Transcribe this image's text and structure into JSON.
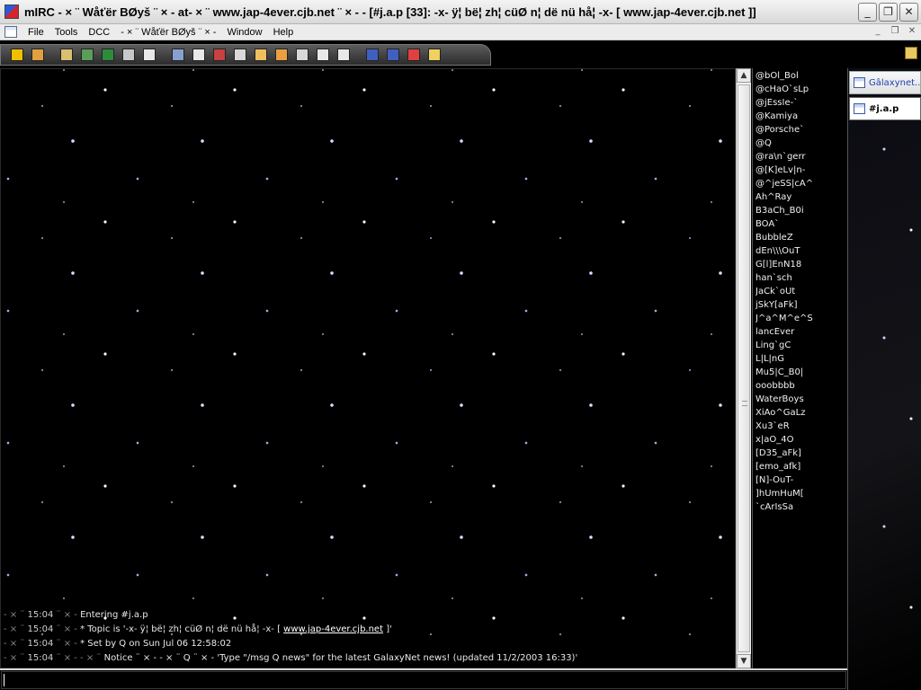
{
  "titlebar": {
    "title": "mIRC - × ¨ Wåťër BØyš ¨ × - at- × ¨ www.jap-4ever.cjb.net ¨ × - - [#j.a.p [33]: -x- ÿ¦ bë¦ zh¦ cüØ n¦ dë nü hå¦ -x- [ www.jap-4ever.cjb.net ]]",
    "minimize": "_",
    "maximize": "❐",
    "close": "✕"
  },
  "menubar": {
    "items": [
      "File",
      "Tools",
      "DCC",
      "- × ¨ Wåťër BØyš ¨ × -",
      "Window",
      "Help"
    ],
    "mdi": [
      "_",
      "❐",
      "✕"
    ]
  },
  "toolbar": {
    "buttons": [
      {
        "name": "connect",
        "color": "#f0c000"
      },
      {
        "name": "options",
        "color": "#e0a040"
      },
      {
        "name": "channels",
        "color": "#d8c070"
      },
      {
        "name": "address-book",
        "color": "#5a9e5a"
      },
      {
        "name": "remote",
        "color": "#2c8c3c"
      },
      {
        "name": "colors",
        "color": "#c8c8c8"
      },
      {
        "name": "channels-list",
        "color": "#e8e8e8"
      },
      {
        "name": "send-file",
        "color": "#88a0d0"
      },
      {
        "name": "timer",
        "color": "#e8e8e8"
      },
      {
        "name": "chat",
        "color": "#c84040"
      },
      {
        "name": "notify",
        "color": "#d8d8d8"
      },
      {
        "name": "log",
        "color": "#f0c060"
      },
      {
        "name": "url",
        "color": "#e8a040"
      },
      {
        "name": "sound",
        "color": "#d8d8d8"
      },
      {
        "name": "tile-horizontal",
        "color": "#e8e8e8"
      },
      {
        "name": "tile-vertical",
        "color": "#e8e8e8"
      },
      {
        "name": "cascade",
        "color": "#4060c0"
      },
      {
        "name": "arrange",
        "color": "#4060c0"
      },
      {
        "name": "help",
        "color": "#e04040"
      },
      {
        "name": "lock",
        "color": "#f0d060"
      }
    ]
  },
  "chat": {
    "lines": [
      {
        "prefix": "- × ¨ ",
        "time": "15:04",
        "sep": " ¨ × - ",
        "text": "Entering #j.a.p",
        "link": ""
      },
      {
        "prefix": "- × ¨ ",
        "time": "15:04",
        "sep": " ¨ × - ",
        "text": "* Topic is '-x- ÿ¦ bë¦ zh¦ cüØ n¦ dë nü hå¦ -x- [ ",
        "link": "www.jap-4ever.cjb.net",
        "suffix": " ]'"
      },
      {
        "prefix": "- × ¨ ",
        "time": "15:04",
        "sep": " ¨ × - ",
        "text": "* Set by Q on Sun Jul 06 12:58:02",
        "link": ""
      },
      {
        "prefix": "- × ¨ ",
        "time": "15:04",
        "sep": " ¨ × - - × ¨ ",
        "text": "Notice ¨ × - - × ¨ Q ¨ × - 'Type \"/msg Q news\" for the latest GalaxyNet news! (updated 11/2/2003 16:33)'",
        "link": ""
      }
    ]
  },
  "nicklist": {
    "nicks": [
      "@bOl_Bol",
      "@cHaO`sLp",
      "@jEssIe-`",
      "@Kamiya",
      "@Porsche`",
      "@Q",
      "@ra\\n`gerr",
      "@[K]eLv|n-",
      "@^jeSS|cA^",
      "Ah^Ray",
      "B3aCh_B0i",
      "BOA`",
      "BubbleZ",
      "dEn\\\\\\OuT",
      "G[l]EnN18",
      "han`sch",
      "JaCk`oUt",
      "jSkY[aFk]",
      "J^a^M^e^S",
      "lancEver",
      "Ling`gC",
      "L|L|nG",
      "Mu5|C_B0|",
      "ooobbbb",
      "WaterBoys",
      "XiAo^GaLz",
      "Xu3`eR",
      "x|aO_4O",
      "[D35_aFk]",
      "[emo_afk]",
      "[N]-OuT-",
      "]hUmHuM[",
      "`cArIsSa"
    ]
  },
  "switchbar": {
    "server": "Gâlaxynet...",
    "channel": "#j.a.p"
  },
  "input": {
    "value": ""
  }
}
